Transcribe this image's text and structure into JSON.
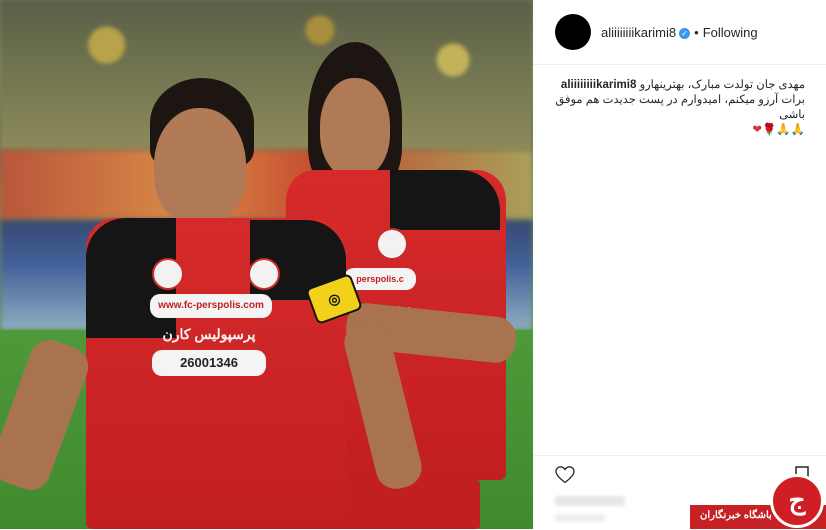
{
  "post": {
    "username": "aliiiiiiiikarimi8",
    "follow_state": "Following",
    "separator": "•",
    "caption": {
      "user": "aliiiiiiiikarimi8",
      "line1": "مهدی جان تولدت مبارک، بهترینهارو",
      "line2": "برات آرزو میکنم، امیدوارم در پست جدیدت هم موفق باشی",
      "emojis": "🙏🙏🌹❤"
    }
  },
  "photo": {
    "jersey_sponsor_url": "www.fc-perspolis.com",
    "jersey_sponsor_fa": "پرسپولیس کارن",
    "jersey_phone": "26001346",
    "jersey_sponsor_url_partial": "perspolis.c",
    "jersey_sponsor_fa_partial": "پرسپو"
  },
  "icons": {
    "verified": "verified-badge-icon",
    "like": "heart-icon",
    "save": "bookmark-icon"
  },
  "watermark": {
    "text": "باشگاه خبرنگاران",
    "logo_glyph": "ج"
  }
}
